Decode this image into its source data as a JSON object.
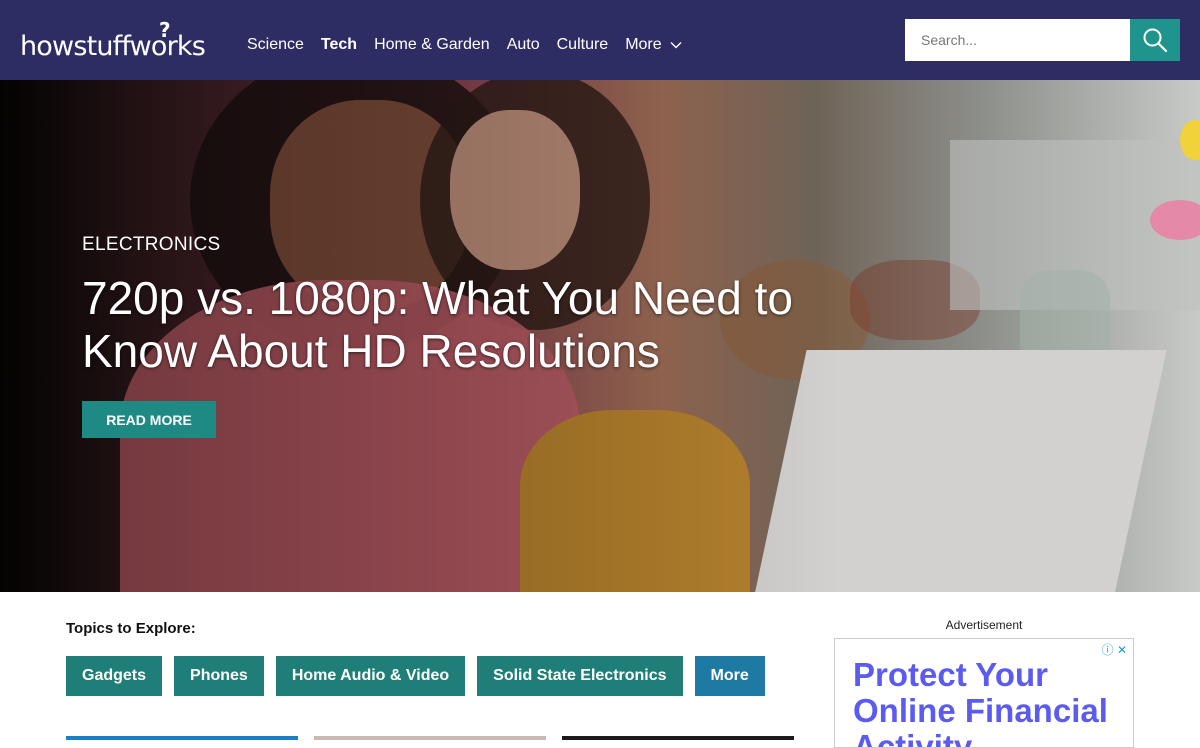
{
  "header": {
    "logo_text": "howstuffworks",
    "logo_mark": "?",
    "nav": [
      {
        "label": "Science",
        "active": false
      },
      {
        "label": "Tech",
        "active": true
      },
      {
        "label": "Home & Garden",
        "active": false
      },
      {
        "label": "Auto",
        "active": false
      },
      {
        "label": "Culture",
        "active": false
      },
      {
        "label": "More",
        "active": false
      }
    ],
    "search_placeholder": "Search...",
    "colors": {
      "background": "#2e2d63",
      "search_button": "#1f948d"
    }
  },
  "hero": {
    "category": "ELECTRONICS",
    "title": "720p vs. 1080p: What You Need to Know About HD Resolutions",
    "button": "READ MORE",
    "button_color": "#1f8a83"
  },
  "topics": {
    "label": "Topics to Explore:",
    "items": [
      "Gadgets",
      "Phones",
      "Home Audio & Video",
      "Solid State Electronics",
      "More"
    ],
    "colors": {
      "topic": "#1f7f78",
      "more": "#1e7aa3"
    }
  },
  "ad": {
    "label": "Advertisement",
    "text": "Protect Your Online Financial Activity",
    "icons": [
      "info-icon",
      "close-icon"
    ]
  },
  "icons": {
    "search": "search-icon",
    "more_chevron": "chevron-down-icon"
  }
}
